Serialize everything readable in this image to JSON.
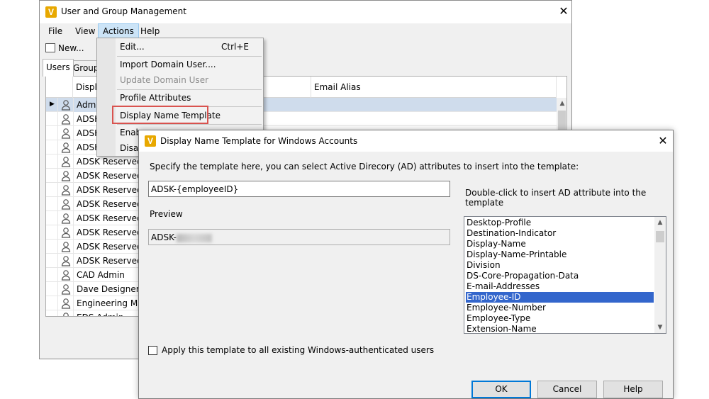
{
  "main_window": {
    "title": "User and Group Management",
    "logo": "V",
    "menu": [
      "File",
      "View",
      "Actions",
      "Help"
    ],
    "toolbar": {
      "new_label": "New..."
    },
    "tabs": [
      "Users",
      "Group"
    ],
    "grid": {
      "columns": [
        "Displa",
        "Email Alias"
      ],
      "rows": [
        "Admi",
        "ADSK",
        "ADSK",
        "ADSK",
        "ADSK Reserved (",
        "ADSK Reserved (A",
        "ADSK Reserved (A",
        "ADSK Reserved (A",
        "ADSK Reserved (A",
        "ADSK Reserved (A",
        "ADSK Reserved (A",
        "ADSK Reserved (A",
        "CAD Admin",
        "Dave Designer",
        "Engineering Mar",
        "EDS Admin"
      ]
    }
  },
  "actions_menu": {
    "items": [
      {
        "label": "Edit...",
        "shortcut": "Ctrl+E",
        "enabled": true
      },
      {
        "label": "Import Domain User....",
        "enabled": true
      },
      {
        "label": "Update Domain User",
        "enabled": false
      },
      {
        "label": "Profile Attributes",
        "enabled": true
      },
      {
        "label": "Display Name Template",
        "enabled": true
      },
      {
        "label": "Enab",
        "enabled": true
      },
      {
        "label": "Disab",
        "enabled": true
      }
    ]
  },
  "dialog": {
    "title": "Display Name Template for Windows Accounts",
    "logo": "V",
    "instruction": "Specify the template here, you can select Active Direcory (AD) attributes to insert into the template:",
    "template_value": "ADSK-{employeeID}",
    "preview_label": "Preview",
    "preview_value": "ADSK-",
    "attr_hint": "Double-click to insert AD attribute into the template",
    "attributes": [
      "Desktop-Profile",
      "Destination-Indicator",
      "Display-Name",
      "Display-Name-Printable",
      "Division",
      "DS-Core-Propagation-Data",
      "E-mail-Addresses",
      "Employee-ID",
      "Employee-Number",
      "Employee-Type",
      "Extension-Name"
    ],
    "selected_attribute": "Employee-ID",
    "apply_label": "Apply this template to all existing Windows-authenticated users",
    "buttons": {
      "ok": "OK",
      "cancel": "Cancel",
      "help": "Help"
    }
  }
}
